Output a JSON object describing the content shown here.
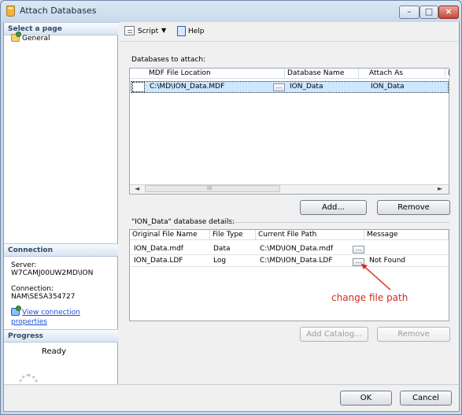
{
  "window": {
    "title": "Attach Databases"
  },
  "left_pane": {
    "select_page": "Select a page",
    "general": "General",
    "connection_header": "Connection",
    "server_label": "Server:",
    "server_value": "W7CAMJ00UW2MD\\ION",
    "connection_label": "Connection:",
    "connection_value": "NAM\\SESA354727",
    "view_connection": "View connection properties",
    "progress_header": "Progress",
    "progress_status": "Ready"
  },
  "toolbar": {
    "script": "Script",
    "help": "Help"
  },
  "attach": {
    "label": "Databases to attach:",
    "columns": [
      "MDF File Location",
      "Database Name",
      "Attach As",
      "("
    ],
    "row": {
      "mdf": "C:\\MD\\ION_Data.MDF",
      "browse": "...",
      "db_name": "ION_Data",
      "attach_as": "ION_Data"
    },
    "scroll_arrow_left": "◄",
    "scroll_arrow_right": "►",
    "scroll_grip": "III",
    "add_button": "Add...",
    "remove_button": "Remove"
  },
  "details": {
    "label": "\"ION_Data\" database details:",
    "columns": [
      "Original File Name",
      "File Type",
      "Current File Path",
      "Message"
    ],
    "rows": [
      {
        "name": "ION_Data.mdf",
        "type": "Data",
        "path": "C:\\MD\\ION_Data.mdf",
        "browse": "...",
        "message": ""
      },
      {
        "name": "ION_Data.LDF",
        "type": "Log",
        "path": "C:\\MD\\ION_Data.LDF",
        "browse": "...",
        "message": "Not Found"
      }
    ],
    "annotation": "change file path",
    "add_catalog": "Add Catalog...",
    "remove_button": "Remove"
  },
  "footer": {
    "ok": "OK",
    "cancel": "Cancel"
  },
  "colors": {
    "accent": "#cce7ff",
    "link": "#1a4ed8",
    "annotation": "#d32b20"
  }
}
